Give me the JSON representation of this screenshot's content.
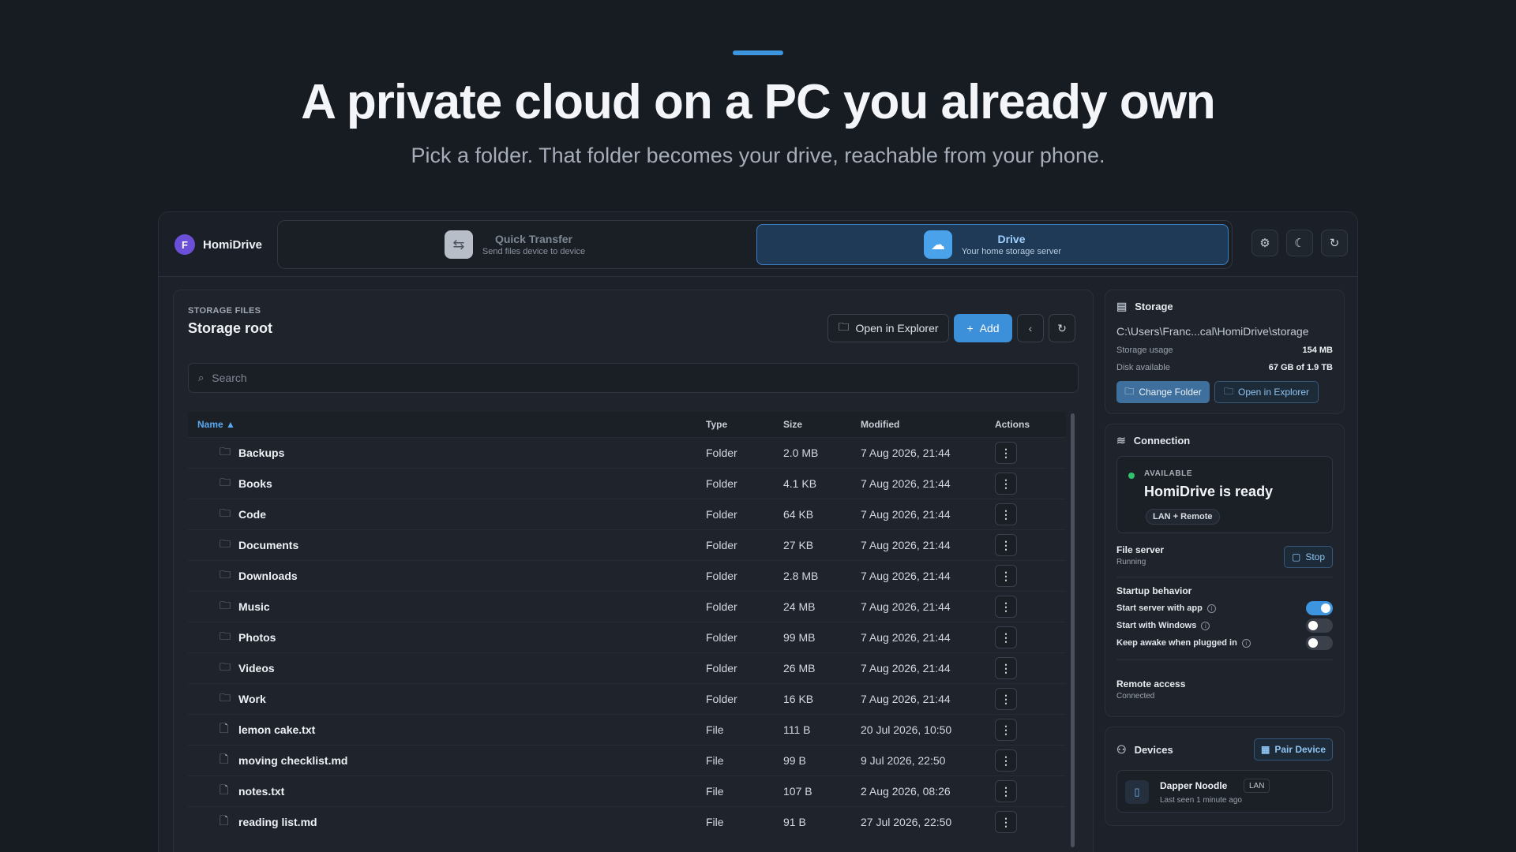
{
  "hero": {
    "title": "A private cloud on a PC you already own",
    "subtitle": "Pick a folder. That folder becomes your drive, reachable from your phone."
  },
  "brand": {
    "initial": "F",
    "name": "HomiDrive"
  },
  "modes": {
    "quick": {
      "title": "Quick Transfer",
      "subtitle": "Send files device to device",
      "icon": "transfer-icon"
    },
    "drive": {
      "title": "Drive",
      "subtitle": "Your home storage server",
      "icon": "cloud-icon",
      "active": true
    }
  },
  "header_actions": [
    "settings-icon",
    "moon-icon",
    "refresh-icon"
  ],
  "files": {
    "kicker": "STORAGE FILES",
    "title": "Storage root",
    "open_label": "Open in Explorer",
    "add_label": "Add",
    "search_placeholder": "Search",
    "columns": {
      "name": "Name ▲",
      "type": "Type",
      "size": "Size",
      "modified": "Modified",
      "actions": "Actions"
    },
    "rows": [
      {
        "name": "Backups",
        "type": "Folder",
        "size": "2.0 MB",
        "modified": "7 Aug 2026, 21:44",
        "icon": "folder-icon"
      },
      {
        "name": "Books",
        "type": "Folder",
        "size": "4.1 KB",
        "modified": "7 Aug 2026, 21:44",
        "icon": "folder-icon"
      },
      {
        "name": "Code",
        "type": "Folder",
        "size": "64 KB",
        "modified": "7 Aug 2026, 21:44",
        "icon": "folder-icon"
      },
      {
        "name": "Documents",
        "type": "Folder",
        "size": "27 KB",
        "modified": "7 Aug 2026, 21:44",
        "icon": "folder-icon"
      },
      {
        "name": "Downloads",
        "type": "Folder",
        "size": "2.8 MB",
        "modified": "7 Aug 2026, 21:44",
        "icon": "folder-icon"
      },
      {
        "name": "Music",
        "type": "Folder",
        "size": "24 MB",
        "modified": "7 Aug 2026, 21:44",
        "icon": "folder-icon"
      },
      {
        "name": "Photos",
        "type": "Folder",
        "size": "99 MB",
        "modified": "7 Aug 2026, 21:44",
        "icon": "folder-icon"
      },
      {
        "name": "Videos",
        "type": "Folder",
        "size": "26 MB",
        "modified": "7 Aug 2026, 21:44",
        "icon": "folder-icon"
      },
      {
        "name": "Work",
        "type": "Folder",
        "size": "16 KB",
        "modified": "7 Aug 2026, 21:44",
        "icon": "folder-icon"
      },
      {
        "name": "lemon cake.txt",
        "type": "File",
        "size": "111 B",
        "modified": "20 Jul 2026, 10:50",
        "icon": "file-icon"
      },
      {
        "name": "moving checklist.md",
        "type": "File",
        "size": "99 B",
        "modified": "9 Jul 2026, 22:50",
        "icon": "file-icon"
      },
      {
        "name": "notes.txt",
        "type": "File",
        "size": "107 B",
        "modified": "2 Aug 2026, 08:26",
        "icon": "file-icon"
      },
      {
        "name": "reading list.md",
        "type": "File",
        "size": "91 B",
        "modified": "27 Jul 2026, 22:50",
        "icon": "file-icon"
      }
    ]
  },
  "storage": {
    "title": "Storage",
    "path": "C:\\Users\\Franc...cal\\HomiDrive\\storage",
    "usage_label": "Storage usage",
    "usage_value": "154 MB",
    "disk_label": "Disk available",
    "disk_value": "67 GB of 1.9 TB",
    "change_label": "Change Folder",
    "open_label": "Open in Explorer"
  },
  "connection": {
    "title": "Connection",
    "status_label": "AVAILABLE",
    "status_title": "HomiDrive is ready",
    "status_badge": "LAN + Remote",
    "server_title": "File server",
    "server_status": "Running",
    "stop_label": "Stop",
    "startup_title": "Startup behavior",
    "toggles": [
      {
        "label": "Start server with app",
        "on": true
      },
      {
        "label": "Start with Windows",
        "on": false
      },
      {
        "label": "Keep awake when plugged in",
        "on": false
      }
    ],
    "remote_title": "Remote access",
    "remote_status": "Connected"
  },
  "devices": {
    "title": "Devices",
    "pair_label": "Pair Device",
    "items": [
      {
        "name": "Dapper Noodle",
        "badge": "LAN",
        "seen": "Last seen 1 minute ago"
      }
    ]
  },
  "colors": {
    "accent": "#3d95e0",
    "background": "#171b22",
    "status_ok": "#2ec26b"
  }
}
